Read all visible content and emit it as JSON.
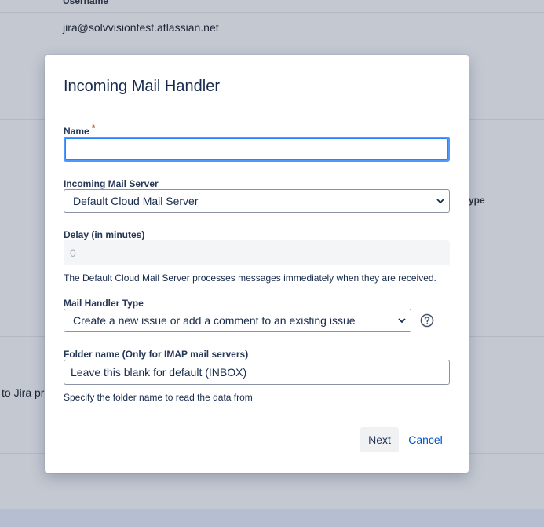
{
  "background": {
    "column_header": "Username",
    "username": "jira@solvvisiontest.atlassian.net",
    "type_fragment": "ype",
    "jira_fragment": "to Jira pro"
  },
  "modal": {
    "title": "Incoming Mail Handler",
    "name_field": {
      "label": "Name",
      "required_mark": "*",
      "value": ""
    },
    "mail_server": {
      "label": "Incoming Mail Server",
      "selected": "Default Cloud Mail Server"
    },
    "delay": {
      "label": "Delay (in minutes)",
      "value": "0",
      "help": "The Default Cloud Mail Server processes messages immediately when they are received."
    },
    "handler_type": {
      "label": "Mail Handler Type",
      "selected": "Create a new issue or add a comment to an existing issue"
    },
    "folder": {
      "label": "Folder name (Only for IMAP mail servers)",
      "placeholder": "Leave this blank for default (INBOX)",
      "help": "Specify the folder name to read the data from"
    },
    "buttons": {
      "next": "Next",
      "cancel": "Cancel"
    }
  },
  "colors": {
    "accent": "#0052cc",
    "focus": "#4c9aff",
    "required": "#de350b",
    "overlay": "#c4c8d1"
  }
}
